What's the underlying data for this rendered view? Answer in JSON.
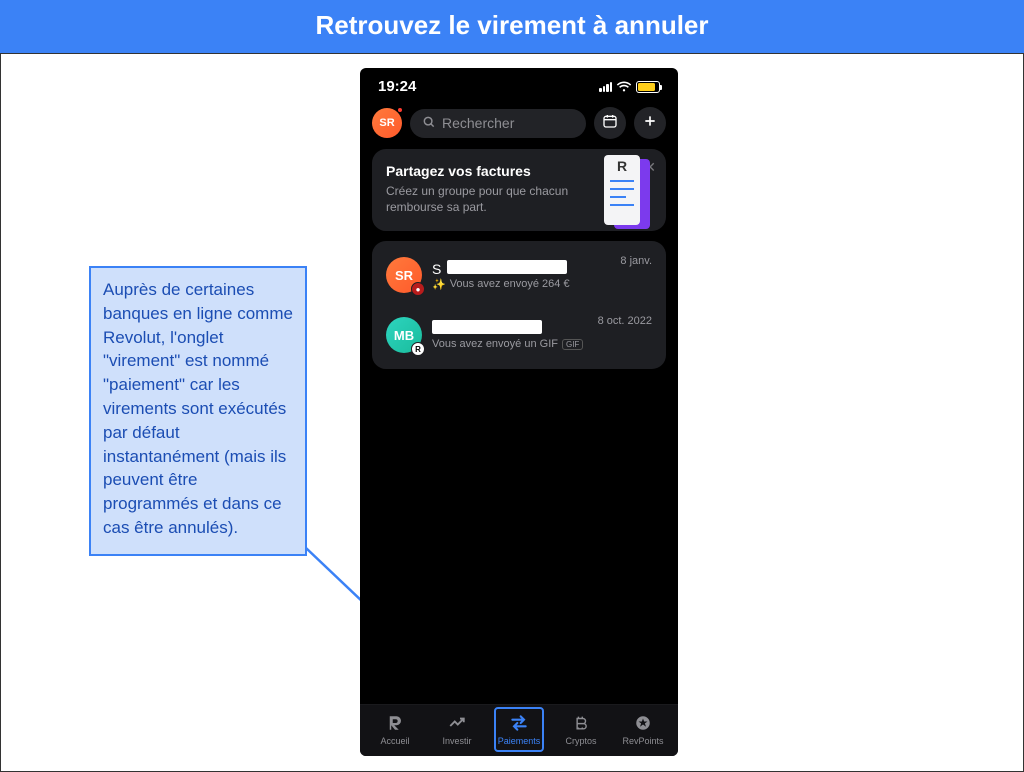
{
  "banner": {
    "title": "Retrouvez le virement à annuler"
  },
  "callout": {
    "text": "Auprès de certaines banques en ligne comme Revolut, l'onglet \"virement\" est nommé \"paiement\" car les virements sont exécutés par défaut instantanément (mais ils peuvent être programmés et dans ce cas être annulés)."
  },
  "phone": {
    "status": {
      "time": "19:24"
    },
    "topbar": {
      "avatar_initials": "SR",
      "search_placeholder": "Rechercher"
    },
    "promo": {
      "title": "Partagez vos factures",
      "subtitle": "Créez un groupe pour que chacun rembourse sa part."
    },
    "transactions": [
      {
        "avatar_initials": "SR",
        "name_prefix": "S",
        "subtitle": "Vous avez envoyé 264 €",
        "date": "8 janv."
      },
      {
        "avatar_initials": "MB",
        "name_prefix": "",
        "subtitle": "Vous avez envoyé un GIF",
        "date": "8 oct. 2022",
        "gif_label": "GIF"
      }
    ],
    "nav": {
      "items": [
        {
          "label": "Accueil"
        },
        {
          "label": "Investir"
        },
        {
          "label": "Paiements"
        },
        {
          "label": "Cryptos"
        },
        {
          "label": "RevPoints"
        }
      ]
    }
  }
}
